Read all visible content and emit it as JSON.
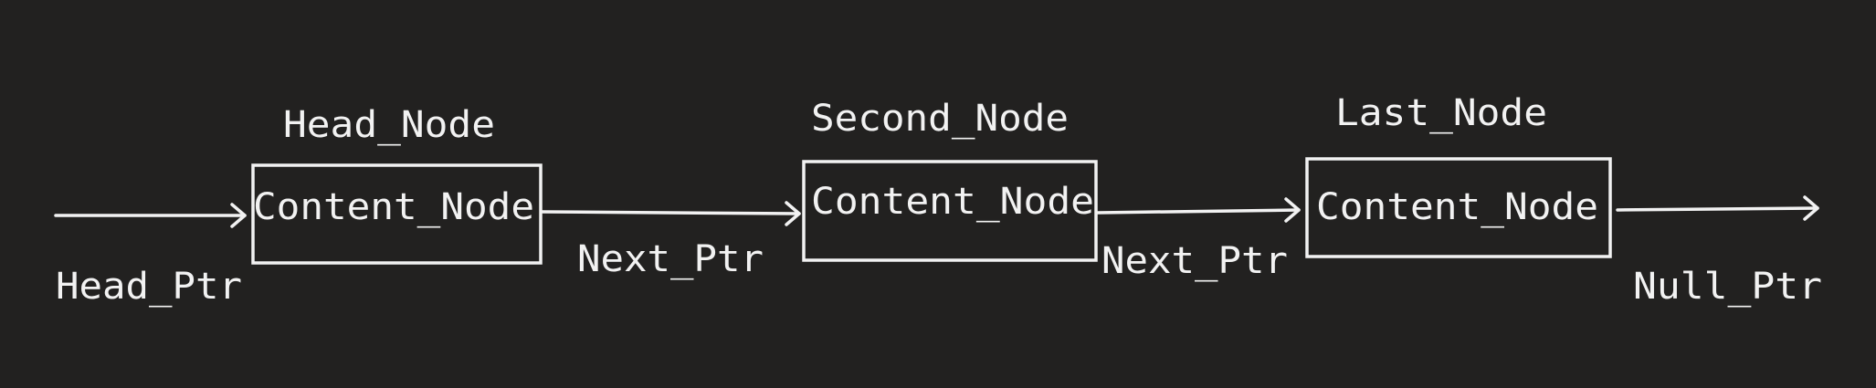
{
  "diagram": {
    "colors": {
      "background": "#222120",
      "stroke": "#f2f2f2",
      "text": "#f2f2f2"
    },
    "head_ptr": "Head_Ptr",
    "nodes": [
      {
        "title": "Head_Node",
        "content": "Content_Node"
      },
      {
        "title": "Second_Node",
        "content": "Content_Node"
      },
      {
        "title": "Last_Node",
        "content": "Content_Node"
      }
    ],
    "next_ptr_1": "Next_Ptr",
    "next_ptr_2": "Next_Ptr",
    "null_ptr": "Null_Ptr"
  }
}
